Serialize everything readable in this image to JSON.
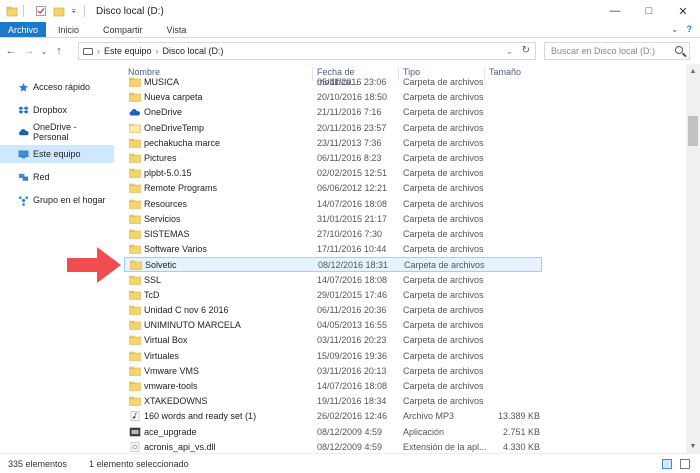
{
  "window": {
    "title": "Disco local (D:)",
    "minimize": "—",
    "maximize": "□",
    "close": "✕"
  },
  "ribbon": {
    "tabs": [
      {
        "label": "Archivo"
      },
      {
        "label": "Inicio"
      },
      {
        "label": "Compartir"
      },
      {
        "label": "Vista"
      }
    ],
    "expand": "⌄",
    "help": "?"
  },
  "address": {
    "back": "←",
    "forward": "→",
    "dropdown": "⌄",
    "up": "↑",
    "crumbs": [
      "Este equipo",
      "Disco local (D:)"
    ],
    "crumb_sep": "›",
    "addr_dropdown": "⌄",
    "refresh": "↻",
    "search_placeholder": "Buscar en Disco local (D:)"
  },
  "nav": {
    "items": [
      {
        "label": "Acceso rápido",
        "icon": "star-icon"
      },
      {
        "label": "Dropbox",
        "icon": "dropbox-icon"
      },
      {
        "label": "OneDrive - Personal",
        "icon": "cloud-icon"
      },
      {
        "label": "Este equipo",
        "icon": "computer-icon",
        "selected": true
      },
      {
        "label": "Red",
        "icon": "network-icon"
      },
      {
        "label": "Grupo en el hogar",
        "icon": "homegroup-icon"
      }
    ]
  },
  "columns": {
    "name": "Nombre",
    "date": "Fecha de modifica...",
    "type": "Tipo",
    "size": "Tamaño",
    "sort_glyph": "^"
  },
  "files": [
    {
      "name": "MUSICA",
      "date": "05/11/2016 23:06",
      "type": "Carpeta de archivos",
      "size": "",
      "icon": "folder"
    },
    {
      "name": "Nueva carpeta",
      "date": "20/10/2016 18:50",
      "type": "Carpeta de archivos",
      "size": "",
      "icon": "folder"
    },
    {
      "name": "OneDrive",
      "date": "21/11/2016 7:16",
      "type": "Carpeta de archivos",
      "size": "",
      "icon": "onedrive"
    },
    {
      "name": "OneDriveTemp",
      "date": "20/11/2016 23:57",
      "type": "Carpeta de archivos",
      "size": "",
      "icon": "folder-light"
    },
    {
      "name": "pechakucha marce",
      "date": "23/11/2013 7:36",
      "type": "Carpeta de archivos",
      "size": "",
      "icon": "folder"
    },
    {
      "name": "Pictures",
      "date": "06/11/2016 8:23",
      "type": "Carpeta de archivos",
      "size": "",
      "icon": "folder"
    },
    {
      "name": "plpbt-5.0.15",
      "date": "02/02/2015 12:51",
      "type": "Carpeta de archivos",
      "size": "",
      "icon": "folder"
    },
    {
      "name": "Remote Programs",
      "date": "06/06/2012 12:21",
      "type": "Carpeta de archivos",
      "size": "",
      "icon": "folder"
    },
    {
      "name": "Resources",
      "date": "14/07/2016 18:08",
      "type": "Carpeta de archivos",
      "size": "",
      "icon": "folder"
    },
    {
      "name": "Servicios",
      "date": "31/01/2015 21:17",
      "type": "Carpeta de archivos",
      "size": "",
      "icon": "folder"
    },
    {
      "name": "SISTEMAS",
      "date": "27/10/2016 7:30",
      "type": "Carpeta de archivos",
      "size": "",
      "icon": "folder"
    },
    {
      "name": "Software Varios",
      "date": "17/11/2016 10:44",
      "type": "Carpeta de archivos",
      "size": "",
      "icon": "folder"
    },
    {
      "name": "Solvetic",
      "date": "08/12/2016 18:31",
      "type": "Carpeta de archivos",
      "size": "",
      "icon": "folder",
      "selected": true
    },
    {
      "name": "SSL",
      "date": "14/07/2016 18:08",
      "type": "Carpeta de archivos",
      "size": "",
      "icon": "folder"
    },
    {
      "name": "TcD",
      "date": "29/01/2015 17:46",
      "type": "Carpeta de archivos",
      "size": "",
      "icon": "folder"
    },
    {
      "name": "Unidad C nov 6 2016",
      "date": "06/11/2016 20:36",
      "type": "Carpeta de archivos",
      "size": "",
      "icon": "folder"
    },
    {
      "name": "UNIMINUTO MARCELA",
      "date": "04/05/2013 16:55",
      "type": "Carpeta de archivos",
      "size": "",
      "icon": "folder"
    },
    {
      "name": "Virtual Box",
      "date": "03/11/2016 20:23",
      "type": "Carpeta de archivos",
      "size": "",
      "icon": "folder"
    },
    {
      "name": "Virtuales",
      "date": "15/09/2016 19:36",
      "type": "Carpeta de archivos",
      "size": "",
      "icon": "folder"
    },
    {
      "name": "Vmware VMS",
      "date": "03/11/2016 20:13",
      "type": "Carpeta de archivos",
      "size": "",
      "icon": "folder"
    },
    {
      "name": "vmware-tools",
      "date": "14/07/2016 18:08",
      "type": "Carpeta de archivos",
      "size": "",
      "icon": "folder"
    },
    {
      "name": "XTAKEDOWNS",
      "date": "19/11/2016 18:34",
      "type": "Carpeta de archivos",
      "size": "",
      "icon": "folder"
    },
    {
      "name": "160 words and ready set (1)",
      "date": "26/02/2016 12:46",
      "type": "Archivo MP3",
      "size": "13.389 KB",
      "icon": "mp3"
    },
    {
      "name": "ace_upgrade",
      "date": "08/12/2009 4:59",
      "type": "Aplicación",
      "size": "2.751 KB",
      "icon": "exe"
    },
    {
      "name": "acronis_api_vs.dll",
      "date": "08/12/2009 4:59",
      "type": "Extensión de la apl...",
      "size": "4.330 KB",
      "icon": "dll"
    }
  ],
  "scroll": {
    "up": "▲",
    "down": "▼"
  },
  "status": {
    "count": "335 elementos",
    "selected": "1 elemento seleccionado"
  },
  "colors": {
    "accent": "#1979ca",
    "folder": "#f6d46b",
    "selection_bg": "#e5f3ff",
    "selection_border": "#99d1ff",
    "annotation_arrow": "#f04e4e"
  }
}
